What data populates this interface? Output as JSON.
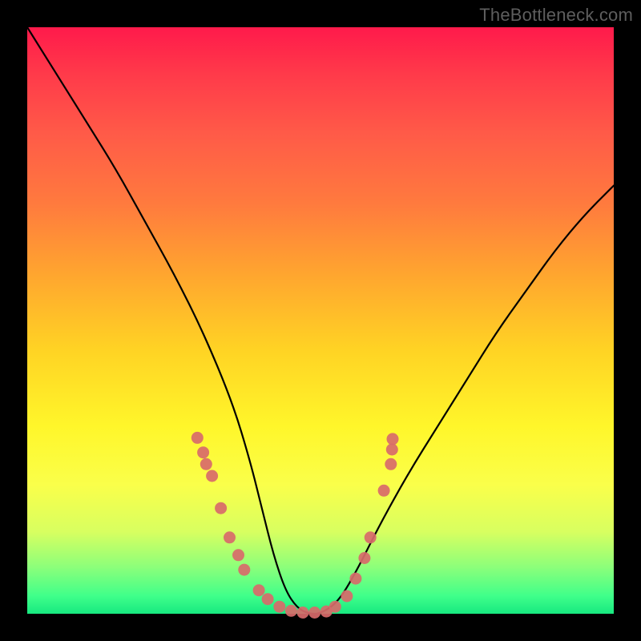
{
  "watermark": "TheBottleneck.com",
  "chart_data": {
    "type": "line",
    "title": "",
    "xlabel": "",
    "ylabel": "",
    "xlim": [
      0,
      1
    ],
    "ylim": [
      0,
      1
    ],
    "series": [
      {
        "name": "bottleneck-curve",
        "x": [
          0.0,
          0.05,
          0.1,
          0.15,
          0.2,
          0.25,
          0.3,
          0.35,
          0.38,
          0.4,
          0.42,
          0.44,
          0.46,
          0.48,
          0.5,
          0.53,
          0.56,
          0.6,
          0.65,
          0.7,
          0.75,
          0.8,
          0.85,
          0.9,
          0.95,
          1.0
        ],
        "y": [
          1.0,
          0.92,
          0.84,
          0.76,
          0.67,
          0.58,
          0.48,
          0.36,
          0.26,
          0.18,
          0.1,
          0.04,
          0.01,
          0.0,
          0.0,
          0.02,
          0.07,
          0.15,
          0.24,
          0.32,
          0.4,
          0.48,
          0.55,
          0.62,
          0.68,
          0.73
        ]
      }
    ],
    "points": {
      "name": "data-points",
      "color": "#d86a6a",
      "xy": [
        [
          0.29,
          0.3
        ],
        [
          0.3,
          0.275
        ],
        [
          0.305,
          0.255
        ],
        [
          0.315,
          0.235
        ],
        [
          0.33,
          0.18
        ],
        [
          0.345,
          0.13
        ],
        [
          0.36,
          0.1
        ],
        [
          0.37,
          0.075
        ],
        [
          0.395,
          0.04
        ],
        [
          0.41,
          0.025
        ],
        [
          0.43,
          0.012
        ],
        [
          0.45,
          0.005
        ],
        [
          0.47,
          0.002
        ],
        [
          0.49,
          0.002
        ],
        [
          0.51,
          0.004
        ],
        [
          0.525,
          0.012
        ],
        [
          0.545,
          0.03
        ],
        [
          0.56,
          0.06
        ],
        [
          0.575,
          0.095
        ],
        [
          0.585,
          0.13
        ],
        [
          0.608,
          0.21
        ],
        [
          0.62,
          0.255
        ],
        [
          0.622,
          0.28
        ],
        [
          0.623,
          0.298
        ]
      ]
    }
  }
}
